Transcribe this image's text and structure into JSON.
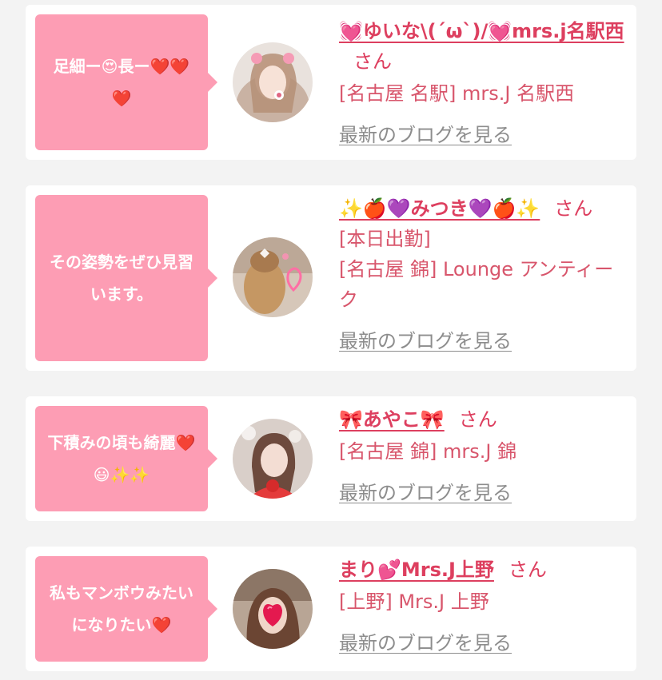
{
  "posts": [
    {
      "comment": "足細ー😍長ー❤️❤️❤️",
      "name": "💓ゆいな\\(´ω`)/💓mrs.j名駅西",
      "san": "さん",
      "lines": [
        "[名古屋 名駅] mrs.J 名駅西"
      ],
      "blog_link": "最新のブログを見る"
    },
    {
      "comment": "その姿勢をぜひ見習います。",
      "name": "✨🍎💜みつき💜🍎✨",
      "san": "さん",
      "lines": [
        "[本日出勤]",
        "[名古屋 錦] Lounge アンティーク"
      ],
      "blog_link": "最新のブログを見る"
    },
    {
      "comment": "下積みの頃も綺麗❤️😃✨✨",
      "name": "🎀あやこ🎀",
      "san": "さん",
      "lines": [
        "[名古屋 錦] mrs.J 錦"
      ],
      "blog_link": "最新のブログを見る"
    },
    {
      "comment": "私もマンボウみたいになりたい❤️",
      "name": "まり💕Mrs.J上野",
      "san": "さん",
      "lines": [
        "[上野] Mrs.J 上野"
      ],
      "blog_link": "最新のブログを見る"
    }
  ],
  "colors": {
    "bubble": "#fd9db4",
    "name": "#dd3f5f",
    "info_text": "#d8566c",
    "link_gray": "#8d8d8d",
    "background": "#f3f3f3"
  }
}
